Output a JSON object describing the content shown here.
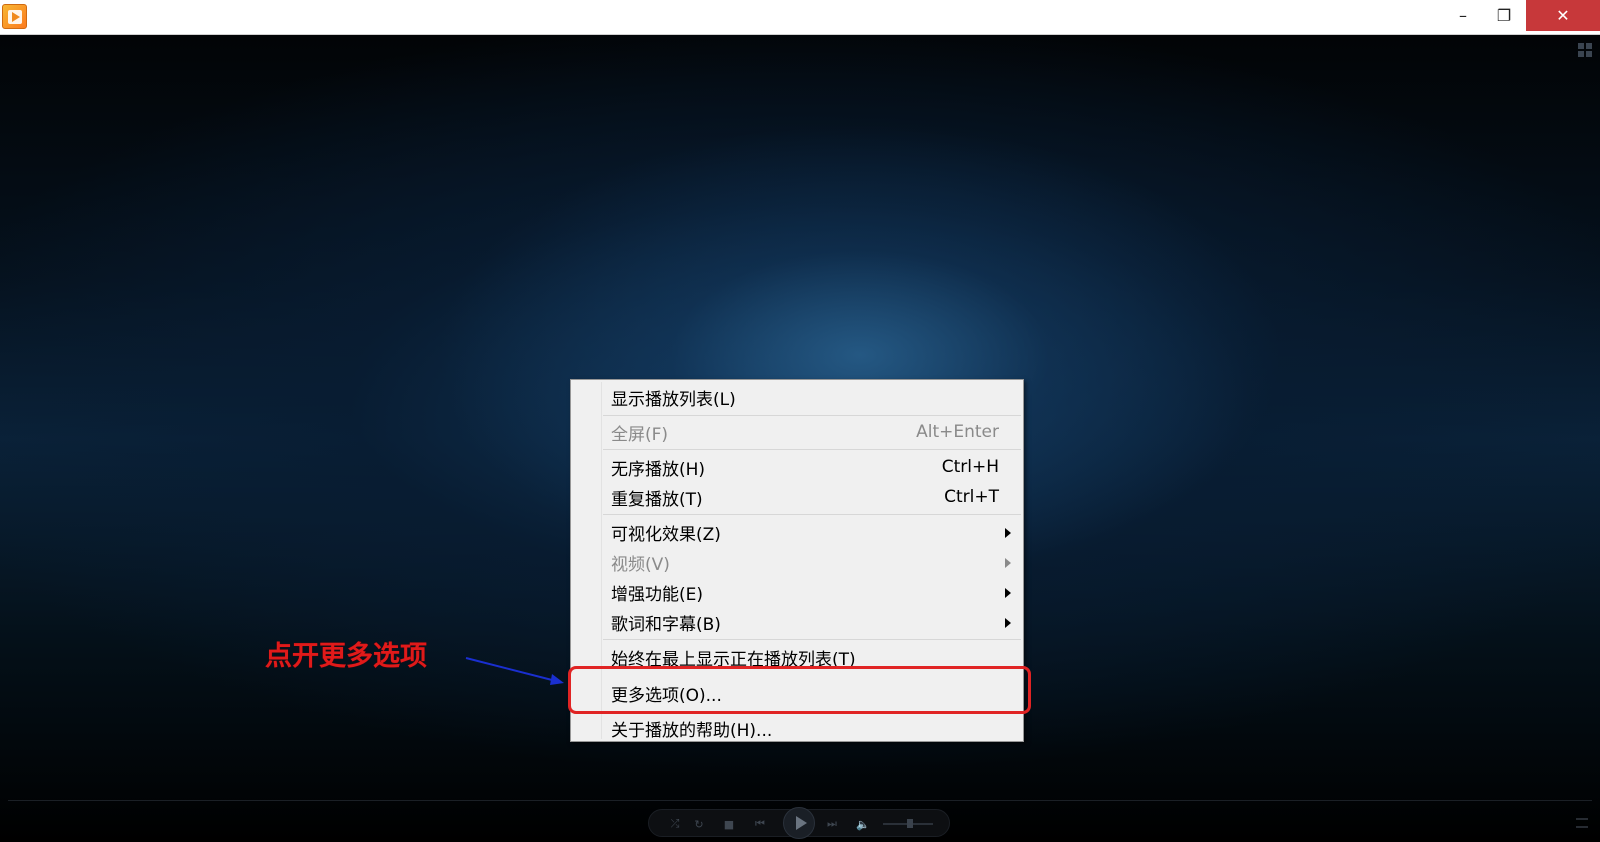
{
  "titlebar": {
    "minimize_glyph": "–",
    "maximize_glyph": "❐",
    "close_glyph": "✕"
  },
  "menu": {
    "items": [
      {
        "label": "显示播放列表(L)",
        "shortcut": "",
        "submenu": false,
        "disabled": false
      },
      {
        "label": "全屏(F)",
        "shortcut": "Alt+Enter",
        "submenu": false,
        "disabled": true
      },
      {
        "label": "无序播放(H)",
        "shortcut": "Ctrl+H",
        "submenu": false,
        "disabled": false
      },
      {
        "label": "重复播放(T)",
        "shortcut": "Ctrl+T",
        "submenu": false,
        "disabled": false
      },
      {
        "label": "可视化效果(Z)",
        "shortcut": "",
        "submenu": true,
        "disabled": false
      },
      {
        "label": "视频(V)",
        "shortcut": "",
        "submenu": true,
        "disabled": true
      },
      {
        "label": "增强功能(E)",
        "shortcut": "",
        "submenu": true,
        "disabled": false
      },
      {
        "label": "歌词和字幕(B)",
        "shortcut": "",
        "submenu": true,
        "disabled": false
      },
      {
        "label": "始终在最上显示正在播放列表(T)",
        "shortcut": "",
        "submenu": false,
        "disabled": false
      },
      {
        "label": "更多选项(O)...",
        "shortcut": "",
        "submenu": false,
        "disabled": false
      },
      {
        "label": "关于播放的帮助(H)...",
        "shortcut": "",
        "submenu": false,
        "disabled": false
      }
    ]
  },
  "annotation": {
    "text": "点开更多选项",
    "color": "#e01a1a",
    "arrow_color": "#1a2fd0",
    "highlight_color": "#e02424"
  },
  "controls": {
    "shuffle_glyph": "⤮",
    "repeat_glyph": "↻",
    "stop_glyph": "■",
    "prev_glyph": "⏮",
    "next_glyph": "⏭",
    "volume_glyph": "🔈"
  },
  "colors": {
    "accent": "#c7383a",
    "menu_bg": "#f0f0f0"
  }
}
